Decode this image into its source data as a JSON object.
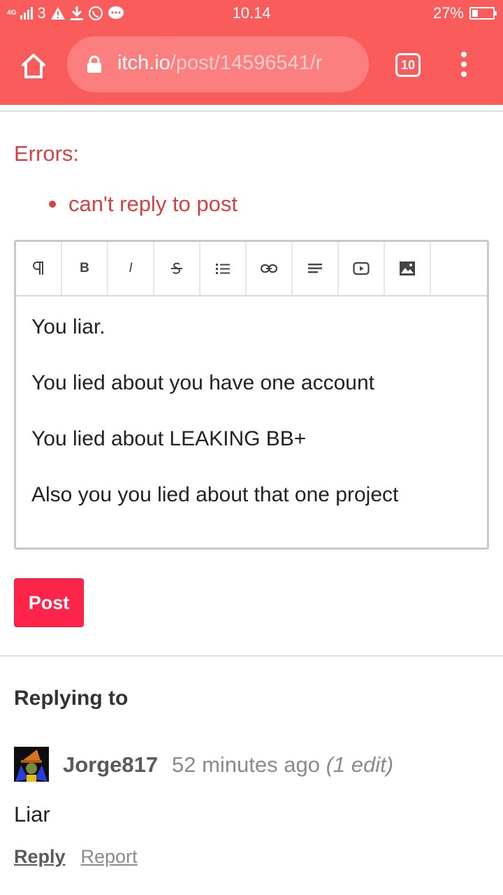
{
  "status_bar": {
    "network": "4G",
    "sim_number": "3",
    "time": "10.14",
    "battery_percent": "27%",
    "battery_level": 0.27,
    "icons": [
      "signal-icon",
      "warning-icon",
      "download-icon",
      "whatsapp-icon",
      "message-icon",
      "battery-icon"
    ]
  },
  "browser": {
    "url_host": "itch.io",
    "url_path": "/post/14596541/r",
    "tab_count": "10"
  },
  "errors": {
    "title": "Errors:",
    "items": [
      "can't reply to post"
    ]
  },
  "editor": {
    "toolbar": [
      "paragraph-icon",
      "bold-icon",
      "italic-icon",
      "strikethrough-icon",
      "list-icon",
      "link-icon",
      "align-icon",
      "video-icon",
      "image-icon"
    ],
    "toolbar_text": {
      "bold": "B",
      "italic": "I"
    },
    "lines": [
      "You liar.",
      "You lied about you have one account",
      "You lied about LEAKING BB+",
      "Also you you lied about that one project"
    ]
  },
  "post_button": "Post",
  "replying": {
    "title": "Replying to",
    "author": "Jorge817",
    "time_ago": "52 minutes ago",
    "edit_note": "(1 edit)",
    "body": "Liar",
    "reply_label": "Reply",
    "report_label": "Report"
  },
  "colors": {
    "chrome": "#fa5c5c",
    "error": "#d14343",
    "post_button": "#ff2449"
  }
}
